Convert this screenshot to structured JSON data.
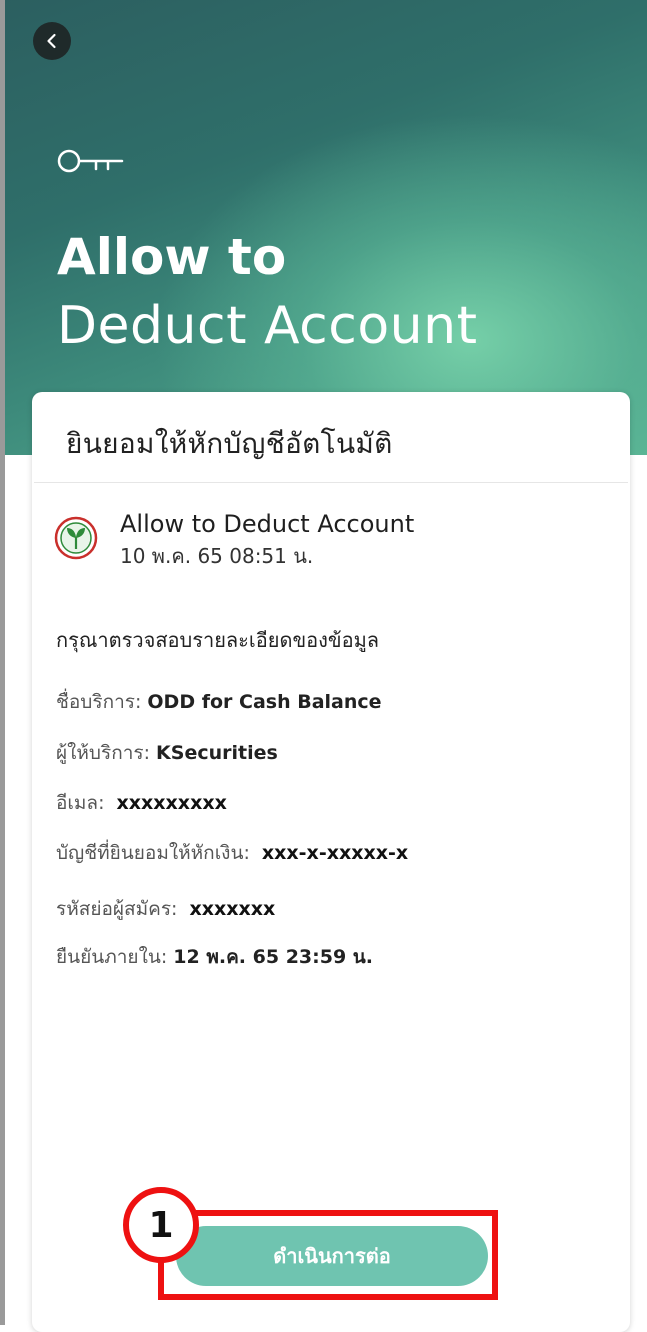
{
  "header": {
    "back_icon": "chevron-left-icon",
    "key_icon": "key-icon",
    "title_line1": "Allow to",
    "title_line2": "Deduct Account"
  },
  "card": {
    "title": "ยินยอมให้หักบัญชีอัตโนมัติ",
    "notice": {
      "logo_icon": "kbank-logo",
      "title": "Allow to Deduct Account",
      "time": "10 พ.ค. 65  08:51 น."
    },
    "check_text": "กรุณาตรวจสอบรายละเอียดของข้อมูล",
    "rows": [
      {
        "label": "ชื่อบริการ:",
        "value": "ODD for Cash Balance"
      },
      {
        "label": "ผู้ให้บริการ:",
        "value": "KSecurities"
      },
      {
        "label": "อีเมล:",
        "value": "xxxxxxxxx"
      },
      {
        "label": "บัญชีที่ยินยอมให้หักเงิน:",
        "value": "xxx-x-xxxxx-x"
      },
      {
        "label": "รหัสย่อผู้สมัคร:",
        "value": "xxxxxxx"
      },
      {
        "label": "ยืนยันภายใน:",
        "value": "12 พ.ค. 65 23:59 น."
      }
    ],
    "continue_button": "ดำเนินการต่อ"
  },
  "annotation": {
    "step_number": "1",
    "color": "#ee1111"
  },
  "colors": {
    "accent": "#6fc4b0",
    "header_dark": "#2c5f60",
    "header_light": "#5ab594"
  }
}
